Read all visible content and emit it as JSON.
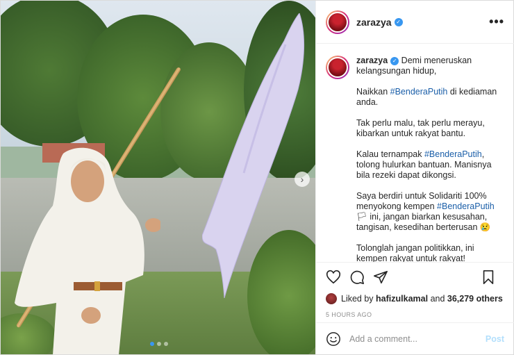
{
  "post": {
    "username": "zarazya",
    "verified": true
  },
  "caption": {
    "username": "zarazya",
    "paragraphs": [
      [
        {
          "text": "Demi meneruskan kelangsungan hidup,",
          "tag": false
        }
      ],
      [
        {
          "text": "Naikkan ",
          "tag": false
        },
        {
          "text": "#BenderaPutih",
          "tag": true
        },
        {
          "text": " di kediaman anda.",
          "tag": false
        }
      ],
      [
        {
          "text": "Tak perlu malu, tak perlu merayu, kibarkan untuk rakyat bantu.",
          "tag": false
        }
      ],
      [
        {
          "text": "Kalau ternampak ",
          "tag": false
        },
        {
          "text": "#BenderaPutih",
          "tag": true
        },
        {
          "text": ", tolong hulurkan bantuan. Manisnya bila rezeki dapat dikongsi.",
          "tag": false
        }
      ],
      [
        {
          "text": "Saya berdiri untuk Solidariti 100% menyokong kempen ",
          "tag": false
        },
        {
          "text": "#BenderaPutih",
          "tag": true
        },
        {
          "text": " 🏳 ini, jangan biarkan kesusahan, tangisan, kesedihan berterusan 😢",
          "tag": false
        }
      ],
      [
        {
          "text": "Tolonglah jangan politikkan, ini kempen rakyat untuk rakyat!",
          "tag": false
        }
      ]
    ]
  },
  "likes": {
    "prefix": "Liked by ",
    "user": "hafizulkamal",
    "middle": " and ",
    "count": "36,279 others"
  },
  "timestamp": "5 HOURS AGO",
  "comment": {
    "placeholder": "Add a comment...",
    "post_label": "Post"
  },
  "carousel": {
    "slides": 3,
    "active": 0,
    "next_arrow": "›"
  },
  "icons": {
    "more": "more-options-icon",
    "like": "heart-icon",
    "comment": "comment-icon",
    "share": "share-icon",
    "save": "bookmark-icon",
    "emoji": "emoji-icon"
  },
  "colors": {
    "verified": "#3897f0",
    "hashtag": "#1a5ea8",
    "post_button_disabled": "#b2dffc"
  }
}
